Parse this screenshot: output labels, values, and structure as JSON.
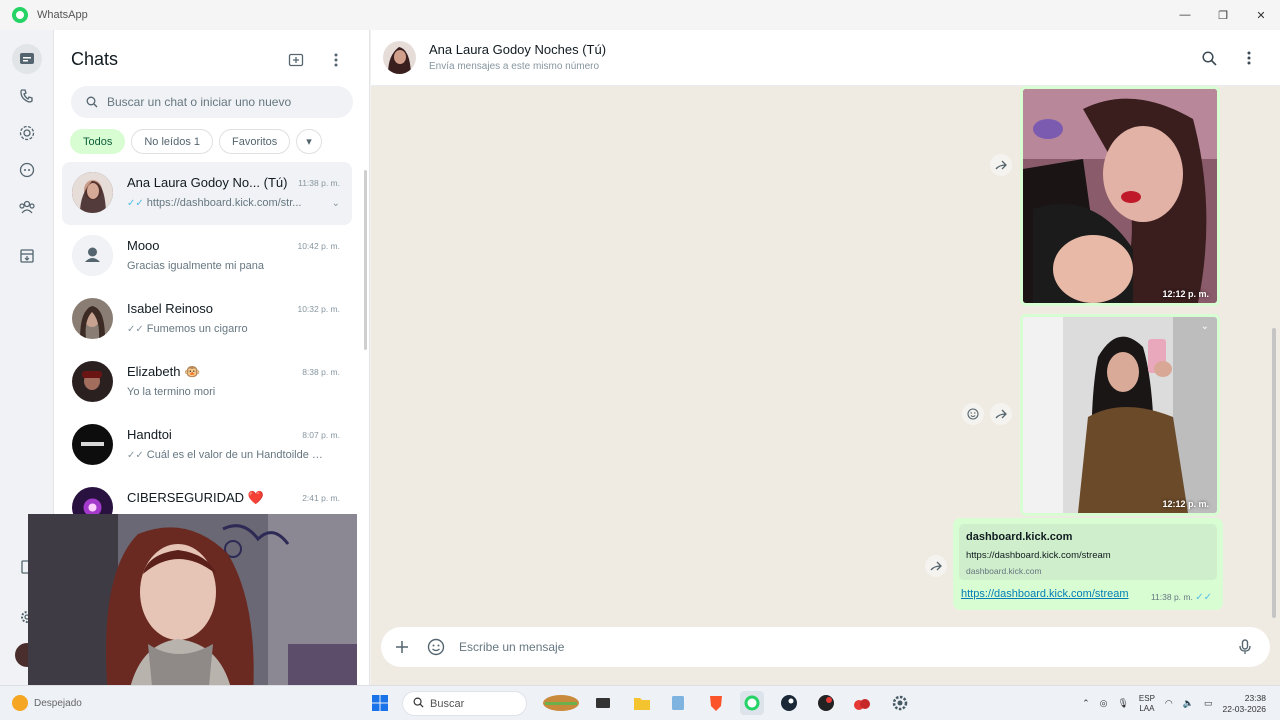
{
  "app": {
    "title": "WhatsApp",
    "window_controls": [
      "—",
      "❐",
      "✕"
    ]
  },
  "rail": {
    "icons": [
      "chats-icon",
      "calls-icon",
      "status-icon",
      "channels-icon",
      "communities-icon",
      "archived-icon",
      "starred-icon",
      "settings-icon",
      "profile-avatar"
    ]
  },
  "chatlist": {
    "title": "Chats",
    "search_placeholder": "Buscar un chat o iniciar uno nuevo",
    "filters": [
      {
        "label": "Todos",
        "active": true
      },
      {
        "label": "No leídos 1",
        "active": false
      },
      {
        "label": "Favoritos",
        "active": false
      }
    ],
    "filters_more": "▾",
    "chats": [
      {
        "name": "Ana Laura Godoy No...",
        "tag": "(Tú)",
        "time": "11:38 p. m.",
        "preview": "https://dashboard.kick.com/str...",
        "read": true,
        "selected": true,
        "avatar_color": "#5a3a3a"
      },
      {
        "name": "Mooo",
        "time": "10:42 p. m.",
        "preview": "Gracias igualmente mi pana",
        "read": false,
        "avatar_color": "#dfe5e7"
      },
      {
        "name": "Isabel Reinoso",
        "time": "10:32 p. m.",
        "preview": "Fumemos un cigarro",
        "read": true,
        "avatar_color": "#6b4a3c"
      },
      {
        "name": "Elizabeth 🐵",
        "time": "8:38 p. m.",
        "preview": "Yo la termino mori",
        "read": false,
        "avatar_color": "#3b2a2a"
      },
      {
        "name": "Handtoi",
        "time": "8:07 p. m.",
        "preview": "Cuál es el valor de un Handtoilde p...",
        "read": true,
        "avatar_color": "#111111"
      },
      {
        "name": "CIBERSEGURIDAD ❤️",
        "time": "2:41 p. m.",
        "preview": "",
        "read": false,
        "avatar_color": "#3a1b4e"
      }
    ]
  },
  "conversation": {
    "title": "Ana Laura Godoy Noches (Tú)",
    "subtitle": "Envía mensajes a este mismo número",
    "messages": [
      {
        "type": "image",
        "time": "12:12 p. m."
      },
      {
        "type": "image",
        "time": "12:12 p. m."
      },
      {
        "type": "link",
        "preview_title": "dashboard.kick.com",
        "preview_url": "https://dashboard.kick.com/stream",
        "preview_domain": "dashboard.kick.com",
        "text": "https://dashboard.kick.com/stream",
        "time": "11:38 p. m."
      }
    ],
    "composer_placeholder": "Escribe un mensaje"
  },
  "taskbar": {
    "weather": "Despejado",
    "search_label": "Buscar",
    "lang_top": "ESP",
    "lang_bottom": "LAA",
    "time": "23:38",
    "date": "22-03-2026"
  }
}
